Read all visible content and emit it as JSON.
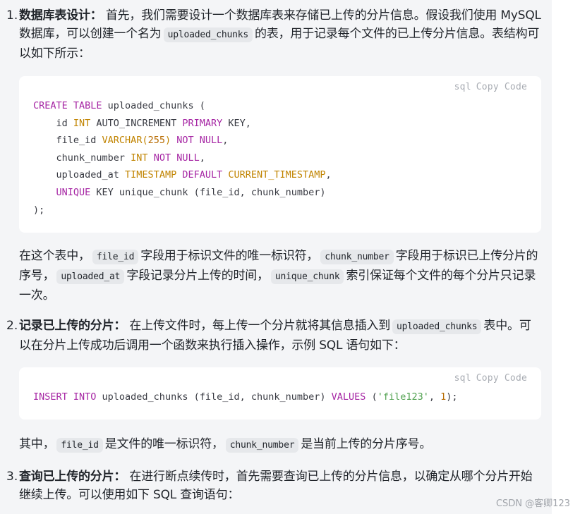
{
  "items": [
    {
      "number": "1.",
      "title": "数据库表设计：",
      "text_a": " 首先，我们需要设计一个数据库表来存储已上传的分片信息。假设我们使用 MySQL 数据库，可以创建一个名为",
      "code_a": "uploaded_chunks",
      "text_b": "的表，用于记录每个文件的已上传分片信息。表结构可以如下所示："
    },
    {
      "number": "2.",
      "title": "记录已上传的分片：",
      "text_a": " 在上传文件时，每上传一个分片就将其信息插入到",
      "code_a": "uploaded_chunks",
      "text_b": "表中。可以在分片上传成功后调用一个函数来执行插入操作，示例 SQL 语句如下："
    },
    {
      "number": "3.",
      "title": "查询已上传的分片：",
      "text_a": " 在进行断点续传时，首先需要查询已上传的分片信息，以确定从哪个分片开始继续上传。可以使用如下 SQL 查询语句："
    }
  ],
  "code_blocks": [
    {
      "language": "sql",
      "copy_label": "Copy",
      "code_label": "Code",
      "lines": [
        [
          {
            "t": "CREATE TABLE",
            "c": "kw"
          },
          {
            "t": " uploaded_chunks (",
            "c": ""
          }
        ],
        [
          {
            "t": "    id ",
            "c": ""
          },
          {
            "t": "INT",
            "c": "ty"
          },
          {
            "t": " AUTO_INCREMENT ",
            "c": ""
          },
          {
            "t": "PRIMARY",
            "c": "kw"
          },
          {
            "t": " KEY,",
            "c": ""
          }
        ],
        [
          {
            "t": "    file_id ",
            "c": ""
          },
          {
            "t": "VARCHAR(",
            "c": "ty"
          },
          {
            "t": "255",
            "c": "nm"
          },
          {
            "t": ")",
            "c": "ty"
          },
          {
            "t": " NOT NULL",
            "c": "kw"
          },
          {
            "t": ",",
            "c": ""
          }
        ],
        [
          {
            "t": "    chunk_number ",
            "c": ""
          },
          {
            "t": "INT",
            "c": "ty"
          },
          {
            "t": " NOT NULL",
            "c": "kw"
          },
          {
            "t": ",",
            "c": ""
          }
        ],
        [
          {
            "t": "    uploaded_at ",
            "c": ""
          },
          {
            "t": "TIMESTAMP",
            "c": "ty"
          },
          {
            "t": " DEFAULT",
            "c": "kw"
          },
          {
            "t": " CURRENT_TIMESTAMP",
            "c": "ty"
          },
          {
            "t": ",",
            "c": ""
          }
        ],
        [
          {
            "t": "    ",
            "c": ""
          },
          {
            "t": "UNIQUE",
            "c": "kw"
          },
          {
            "t": " KEY unique_chunk (file_id, chunk_number)",
            "c": ""
          }
        ],
        [
          {
            "t": ");",
            "c": ""
          }
        ]
      ]
    },
    {
      "language": "sql",
      "copy_label": "Copy",
      "code_label": "Code",
      "lines": [
        [
          {
            "t": "INSERT INTO",
            "c": "kw"
          },
          {
            "t": " uploaded_chunks (file_id, chunk_number) ",
            "c": ""
          },
          {
            "t": "VALUES",
            "c": "kw"
          },
          {
            "t": " (",
            "c": ""
          },
          {
            "t": "'file123'",
            "c": "st"
          },
          {
            "t": ", ",
            "c": ""
          },
          {
            "t": "1",
            "c": "nm"
          },
          {
            "t": ");",
            "c": ""
          }
        ]
      ]
    }
  ],
  "explain1": {
    "t1": "在这个表中，",
    "c1": "file_id",
    "t2": "字段用于标识文件的唯一标识符，",
    "c2": "chunk_number",
    "t3": "字段用于标识已上传分片的序号，",
    "c3": "uploaded_at",
    "t4": "字段记录分片上传的时间，",
    "c4": "unique_chunk",
    "t5": "索引保证每个文件的每个分片只记录一次。"
  },
  "explain2": {
    "t1": "其中，",
    "c1": "file_id",
    "t2": "是文件的唯一标识符，",
    "c2": "chunk_number",
    "t3": "是当前上传的分片序号。"
  },
  "watermark": "CSDN @客卿123"
}
